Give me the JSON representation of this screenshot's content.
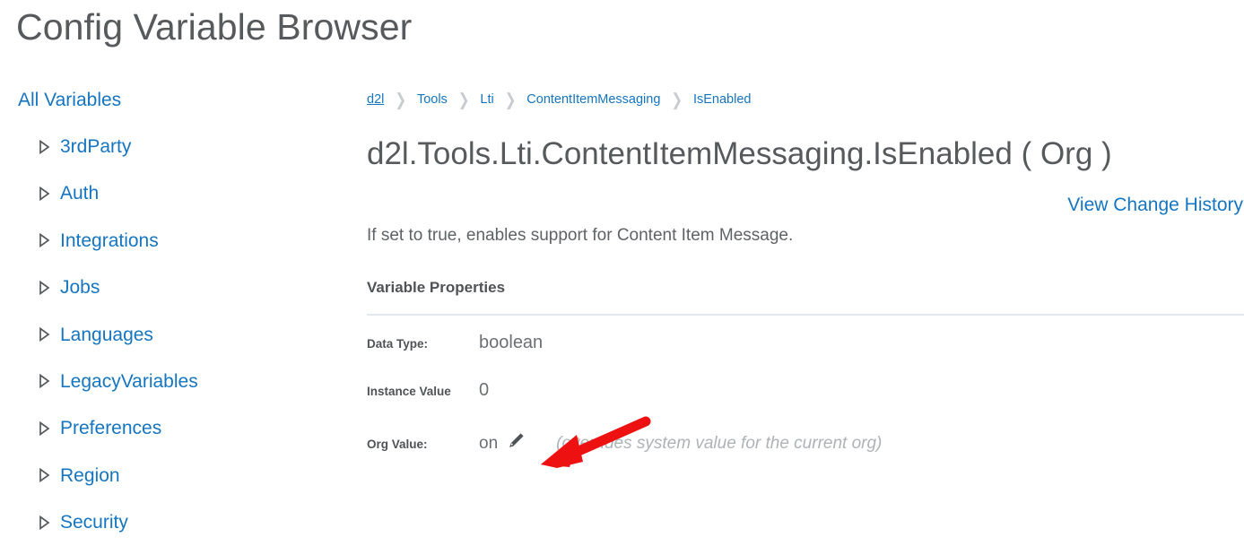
{
  "page": {
    "title": "Config Variable Browser"
  },
  "sidebar": {
    "root_label": "All Variables",
    "expand_icon": "triangle-right-icon",
    "items": [
      {
        "label": "3rdParty"
      },
      {
        "label": "Auth"
      },
      {
        "label": "Integrations"
      },
      {
        "label": "Jobs"
      },
      {
        "label": "Languages"
      },
      {
        "label": "LegacyVariables"
      },
      {
        "label": "Preferences"
      },
      {
        "label": "Region"
      },
      {
        "label": "Security"
      }
    ]
  },
  "main": {
    "breadcrumb": {
      "separator": "❯",
      "items": [
        {
          "label": "d2l"
        },
        {
          "label": "Tools"
        },
        {
          "label": "Lti"
        },
        {
          "label": "ContentItemMessaging"
        },
        {
          "label": "IsEnabled"
        }
      ]
    },
    "variable_heading": "d2l.Tools.Lti.ContentItemMessaging.IsEnabled ( Org )",
    "history_link": "View Change History",
    "description": "If set to true, enables support for Content Item Message.",
    "properties_heading": "Variable Properties",
    "properties": [
      {
        "label": "Data Type:",
        "value": "boolean",
        "note": "",
        "has_edit": false
      },
      {
        "label": "Instance Value",
        "value": "0",
        "note": "",
        "has_edit": false
      },
      {
        "label": "Org Value:",
        "value": "on",
        "note": "(overrides system value for the current org)",
        "has_edit": true,
        "edit_icon": "pencil-icon"
      }
    ]
  },
  "annotation": {
    "type": "arrow",
    "color": "#ee1111",
    "points_to": "pencil-icon"
  },
  "colors": {
    "link": "#1675c0",
    "text": "#565a5c",
    "muted": "#aeb3b6",
    "rule": "#e3e8ee",
    "annotation_red": "#ee1111"
  }
}
